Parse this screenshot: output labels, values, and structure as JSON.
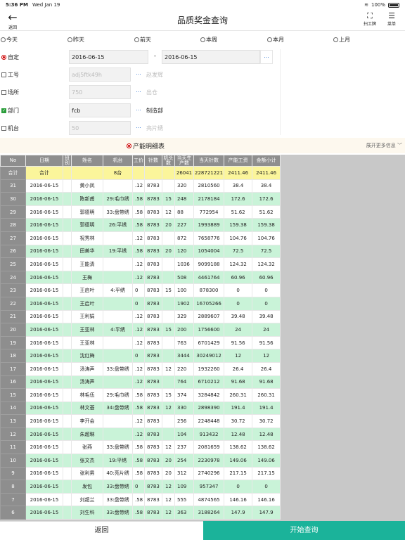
{
  "status_bar": {
    "time": "5:36 PM",
    "date": "Wed Jan 19",
    "battery": "100%"
  },
  "nav": {
    "back_label": "返回",
    "title": "品质奖金查询",
    "scan_label": "扫工牌",
    "menu_label": "菜单"
  },
  "date_options": [
    {
      "label": "今天",
      "selected": false
    },
    {
      "label": "昨天",
      "selected": false
    },
    {
      "label": "前天",
      "selected": false
    },
    {
      "label": "本周",
      "selected": false
    },
    {
      "label": "本月",
      "selected": false
    },
    {
      "label": "上月",
      "selected": false
    }
  ],
  "filters": {
    "custom": {
      "label": "自定",
      "selected": true,
      "start": "2016-06-15",
      "end": "2016-06-15",
      "dash": "-",
      "dots": "..."
    },
    "worker": {
      "label": "工号",
      "checked": false,
      "value": "adj5ftk49h",
      "name": "赵发辉",
      "dots": "..."
    },
    "site": {
      "label": "场所",
      "checked": false,
      "value": "750",
      "name": "出仓",
      "dots": "..."
    },
    "dept": {
      "label": "部门",
      "checked": true,
      "value": "fcb",
      "name": "制造部",
      "dots": "..."
    },
    "machine": {
      "label": "机台",
      "checked": false,
      "value": "50",
      "name": "亮片绣",
      "dots": "..."
    }
  },
  "section": {
    "title": "产能明细表",
    "more": "展开更多信息"
  },
  "table": {
    "headers": [
      "No",
      "日期",
      "班别",
      "姓名",
      "机台",
      "工价",
      "针数",
      "机头数",
      "当天生产数",
      "当天针数",
      "产能工资",
      "金额小计"
    ],
    "total": {
      "no": "合计",
      "date": "合计",
      "shift": "",
      "name": "",
      "machine": "8台",
      "price": "",
      "stitch": "",
      "heads": "",
      "qty": "26041",
      "needles": "228721221",
      "wage": "2411.46",
      "subtotal": "2411.46"
    },
    "rows": [
      {
        "no": "31",
        "date": "2016-06-15",
        "name": "黄小凤",
        "machine": "",
        "price": ".12",
        "stitch": "8783",
        "heads": "",
        "qty": "320",
        "needles": "2810560",
        "wage": "38.4",
        "subtotal": "38.4"
      },
      {
        "no": "30",
        "date": "2016-06-15",
        "name": "陈新甫",
        "machine": "29:毛巾绣",
        "price": ".58",
        "stitch": "8783",
        "heads": "15",
        "qty": "248",
        "needles": "2178184",
        "wage": "172.6",
        "subtotal": "172.6"
      },
      {
        "no": "29",
        "date": "2016-06-15",
        "name": "郭德明",
        "machine": "33:盘带绣",
        "price": ".58",
        "stitch": "8783",
        "heads": "12",
        "qty": "88",
        "needles": "772954",
        "wage": "51.62",
        "subtotal": "51.62"
      },
      {
        "no": "28",
        "date": "2016-06-15",
        "name": "郭德明",
        "machine": "26:平绣",
        "price": ".58",
        "stitch": "8783",
        "heads": "20",
        "qty": "227",
        "needles": "1993889",
        "wage": "159.38",
        "subtotal": "159.38"
      },
      {
        "no": "27",
        "date": "2016-06-15",
        "name": "祝秀林",
        "machine": "",
        "price": ".12",
        "stitch": "8783",
        "heads": "",
        "qty": "872",
        "needles": "7658776",
        "wage": "104.76",
        "subtotal": "104.76"
      },
      {
        "no": "26",
        "date": "2016-06-15",
        "name": "田美华",
        "machine": "19:平绣",
        "price": ".58",
        "stitch": "8783",
        "heads": "20",
        "qty": "120",
        "needles": "1054004",
        "wage": "72.5",
        "subtotal": "72.5"
      },
      {
        "no": "25",
        "date": "2016-06-15",
        "name": "王能清",
        "machine": "",
        "price": ".12",
        "stitch": "8783",
        "heads": "",
        "qty": "1036",
        "needles": "9099188",
        "wage": "124.32",
        "subtotal": "124.32"
      },
      {
        "no": "24",
        "date": "2016-06-15",
        "name": "王梅",
        "machine": "",
        "price": ".12",
        "stitch": "8783",
        "heads": "",
        "qty": "508",
        "needles": "4461764",
        "wage": "60.96",
        "subtotal": "60.96"
      },
      {
        "no": "23",
        "date": "2016-06-15",
        "name": "王启叶",
        "machine": "4:平绣",
        "price": "0",
        "stitch": "8783",
        "heads": "15",
        "qty": "100",
        "needles": "878300",
        "wage": "0",
        "subtotal": "0"
      },
      {
        "no": "22",
        "date": "2016-06-15",
        "name": "王启叶",
        "machine": "",
        "price": "0",
        "stitch": "8783",
        "heads": "",
        "qty": "1902",
        "needles": "16705266",
        "wage": "0",
        "subtotal": "0"
      },
      {
        "no": "21",
        "date": "2016-06-15",
        "name": "王利娟",
        "machine": "",
        "price": ".12",
        "stitch": "8783",
        "heads": "",
        "qty": "329",
        "needles": "2889607",
        "wage": "39.48",
        "subtotal": "39.48"
      },
      {
        "no": "20",
        "date": "2016-06-15",
        "name": "王亚林",
        "machine": "4:平绣",
        "price": ".12",
        "stitch": "8783",
        "heads": "15",
        "qty": "200",
        "needles": "1756600",
        "wage": "24",
        "subtotal": "24"
      },
      {
        "no": "19",
        "date": "2016-06-15",
        "name": "王亚林",
        "machine": "",
        "price": ".12",
        "stitch": "8783",
        "heads": "",
        "qty": "763",
        "needles": "6701429",
        "wage": "91.56",
        "subtotal": "91.56"
      },
      {
        "no": "18",
        "date": "2016-06-15",
        "name": "沈红梅",
        "machine": "",
        "price": "0",
        "stitch": "8783",
        "heads": "",
        "qty": "3444",
        "needles": "30249012",
        "wage": "12",
        "subtotal": "12"
      },
      {
        "no": "17",
        "date": "2016-06-15",
        "name": "汤涛声",
        "machine": "33:盘带绣",
        "price": ".12",
        "stitch": "8783",
        "heads": "12",
        "qty": "220",
        "needles": "1932260",
        "wage": "26.4",
        "subtotal": "26.4"
      },
      {
        "no": "16",
        "date": "2016-06-15",
        "name": "汤涛声",
        "machine": "",
        "price": ".12",
        "stitch": "8783",
        "heads": "",
        "qty": "764",
        "needles": "6710212",
        "wage": "91.68",
        "subtotal": "91.68"
      },
      {
        "no": "15",
        "date": "2016-06-15",
        "name": "林毛伍",
        "machine": "29:毛巾绣",
        "price": ".58",
        "stitch": "8783",
        "heads": "15",
        "qty": "374",
        "needles": "3284842",
        "wage": "260.31",
        "subtotal": "260.31"
      },
      {
        "no": "14",
        "date": "2016-06-15",
        "name": "林文荟",
        "machine": "34:盘带绣",
        "price": ".58",
        "stitch": "8783",
        "heads": "12",
        "qty": "330",
        "needles": "2898390",
        "wage": "191.4",
        "subtotal": "191.4"
      },
      {
        "no": "13",
        "date": "2016-06-15",
        "name": "李开会",
        "machine": "",
        "price": ".12",
        "stitch": "8783",
        "heads": "",
        "qty": "256",
        "needles": "2248448",
        "wage": "30.72",
        "subtotal": "30.72"
      },
      {
        "no": "12",
        "date": "2016-06-15",
        "name": "朱超琳",
        "machine": "",
        "price": ".12",
        "stitch": "8783",
        "heads": "",
        "qty": "104",
        "needles": "913432",
        "wage": "12.48",
        "subtotal": "12.48"
      },
      {
        "no": "11",
        "date": "2016-06-15",
        "name": "张燕",
        "machine": "33:盘带绣",
        "price": ".58",
        "stitch": "8783",
        "heads": "12",
        "qty": "237",
        "needles": "2081659",
        "wage": "138.62",
        "subtotal": "138.62"
      },
      {
        "no": "10",
        "date": "2016-06-15",
        "name": "张文杰",
        "machine": "19:平绣",
        "price": ".58",
        "stitch": "8783",
        "heads": "20",
        "qty": "254",
        "needles": "2230978",
        "wage": "149.06",
        "subtotal": "149.06"
      },
      {
        "no": "9",
        "date": "2016-06-15",
        "name": "张利男",
        "machine": "40:亮片绣",
        "price": ".58",
        "stitch": "8783",
        "heads": "20",
        "qty": "312",
        "needles": "2740296",
        "wage": "217.15",
        "subtotal": "217.15"
      },
      {
        "no": "8",
        "date": "2016-06-15",
        "name": "发包",
        "machine": "33:盘带绣",
        "price": "0",
        "stitch": "8783",
        "heads": "12",
        "qty": "109",
        "needles": "957347",
        "wage": "0",
        "subtotal": "0"
      },
      {
        "no": "7",
        "date": "2016-06-15",
        "name": "刘超兰",
        "machine": "33:盘带绣",
        "price": ".58",
        "stitch": "8783",
        "heads": "12",
        "qty": "555",
        "needles": "4874565",
        "wage": "146.16",
        "subtotal": "146.16"
      },
      {
        "no": "6",
        "date": "2016-06-15",
        "name": "刘生科",
        "machine": "33:盘带绣",
        "price": ".58",
        "stitch": "8783",
        "heads": "12",
        "qty": "363",
        "needles": "3188264",
        "wage": "147.9",
        "subtotal": "147.9"
      }
    ]
  },
  "bottom": {
    "back": "返回",
    "query": "开始查询"
  }
}
